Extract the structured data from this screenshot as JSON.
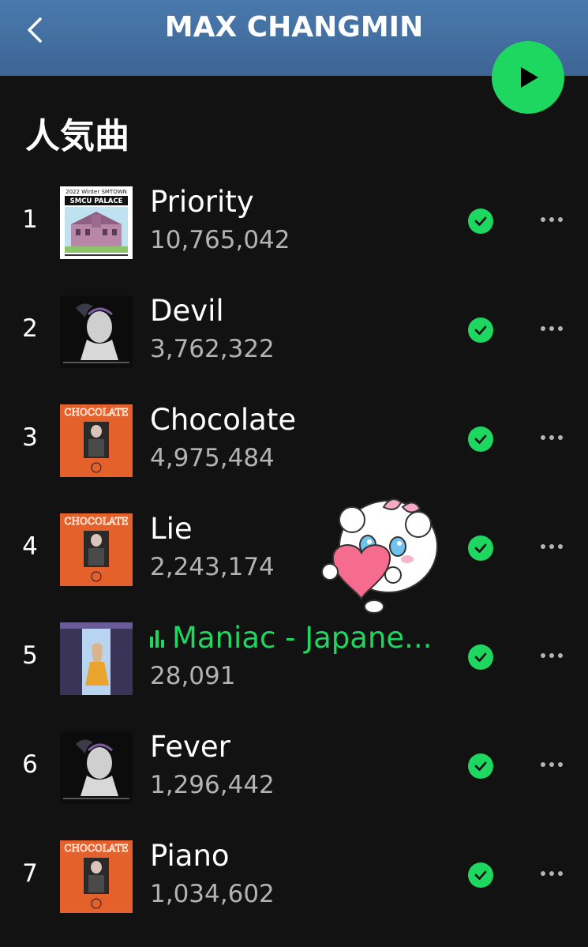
{
  "header": {
    "title": "MAX CHANGMIN",
    "back_icon": "chevron-left-icon",
    "play_icon": "play-icon",
    "accent": "#1ed760",
    "bar_color": "#4373a8"
  },
  "section": {
    "title": "人気曲"
  },
  "tracks": [
    {
      "num": "1",
      "title": "Priority",
      "plays": "10,765,042",
      "cover": "smcu",
      "cover_text_top": "2022 Winter SMTOWN",
      "cover_text_main": "SMCU PALACE",
      "playing": false
    },
    {
      "num": "2",
      "title": "Devil",
      "plays": "3,762,322",
      "cover": "devil",
      "playing": false
    },
    {
      "num": "3",
      "title": "Chocolate",
      "plays": "4,975,484",
      "cover": "choc",
      "cover_text_main": "CHOCOLATE",
      "playing": false
    },
    {
      "num": "4",
      "title": "Lie",
      "plays": "2,243,174",
      "cover": "choc",
      "cover_text_main": "CHOCOLATE",
      "playing": false
    },
    {
      "num": "5",
      "title": "Maniac - Japane...",
      "plays": "28,091",
      "cover": "maniac",
      "playing": true
    },
    {
      "num": "6",
      "title": "Fever",
      "plays": "1,296,442",
      "cover": "devil",
      "playing": false
    },
    {
      "num": "7",
      "title": "Piano",
      "plays": "1,034,602",
      "cover": "choc",
      "cover_text_main": "CHOCOLATE",
      "playing": false
    }
  ],
  "icons": {
    "liked": "check-circle-icon",
    "more": "more-horizontal-icon",
    "playing": "equalizer-icon",
    "sticker": "heart-sticker-icon"
  }
}
